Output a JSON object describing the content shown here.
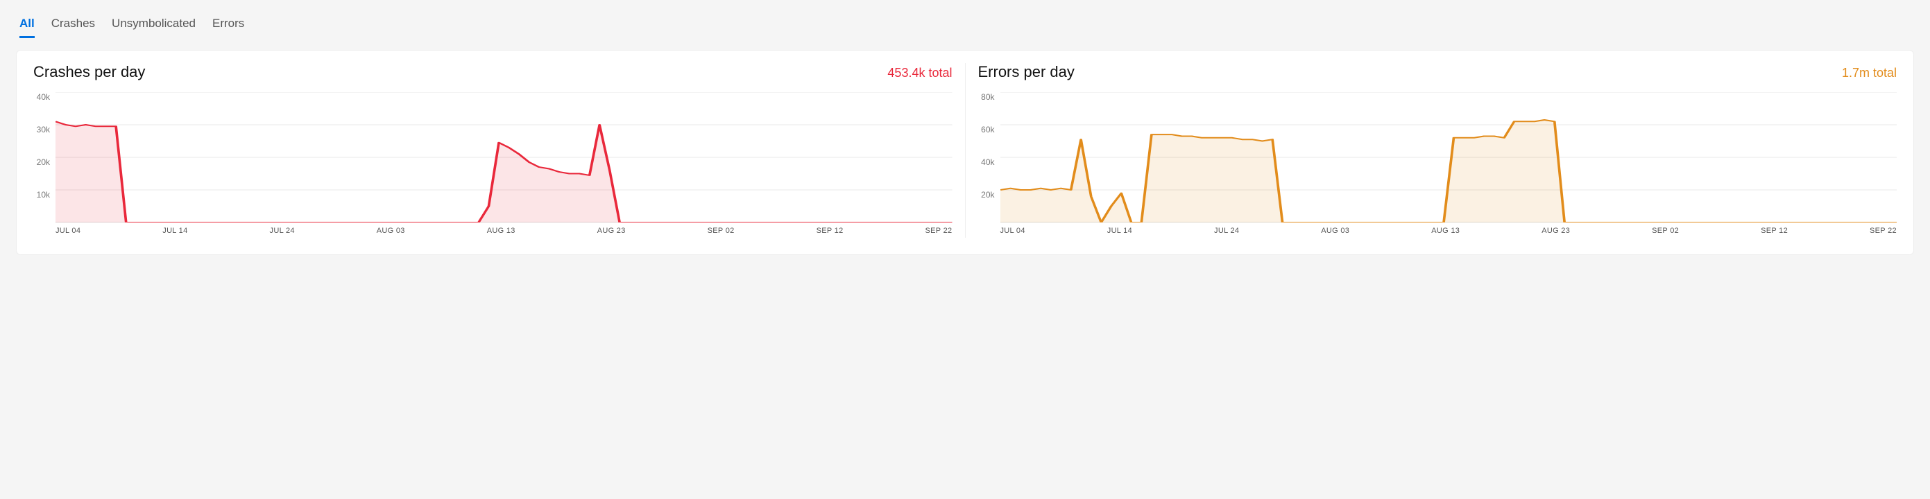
{
  "tabs": [
    {
      "label": "All",
      "active": true
    },
    {
      "label": "Crashes",
      "active": false
    },
    {
      "label": "Unsymbolicated",
      "active": false
    },
    {
      "label": "Errors",
      "active": false
    }
  ],
  "charts": [
    {
      "title": "Crashes per day",
      "total": "453.4k total",
      "color": "red",
      "ymax": 40000,
      "y_ticks": [
        "40k",
        "30k",
        "20k",
        "10k"
      ]
    },
    {
      "title": "Errors per day",
      "total": "1.7m total",
      "color": "orange",
      "ymax": 80000,
      "y_ticks": [
        "80k",
        "60k",
        "40k",
        "20k"
      ]
    }
  ],
  "x_ticks": [
    "JUL 04",
    "JUL 14",
    "JUL 24",
    "AUG 03",
    "AUG 13",
    "AUG 23",
    "SEP 02",
    "SEP 12",
    "SEP 22"
  ],
  "chart_data": [
    {
      "type": "area",
      "title": "Crashes per day",
      "xlabel": "",
      "ylabel": "",
      "ylim": [
        0,
        40000
      ],
      "x": [
        "2016-07-04",
        "2016-07-05",
        "2016-07-06",
        "2016-07-07",
        "2016-07-08",
        "2016-07-09",
        "2016-07-10",
        "2016-07-11",
        "2016-07-12",
        "2016-07-13",
        "2016-07-14",
        "2016-07-15",
        "2016-07-16",
        "2016-07-17",
        "2016-07-18",
        "2016-07-19",
        "2016-07-20",
        "2016-07-21",
        "2016-07-22",
        "2016-07-23",
        "2016-07-24",
        "2016-07-25",
        "2016-07-26",
        "2016-07-27",
        "2016-07-28",
        "2016-07-29",
        "2016-07-30",
        "2016-07-31",
        "2016-08-01",
        "2016-08-02",
        "2016-08-03",
        "2016-08-04",
        "2016-08-05",
        "2016-08-06",
        "2016-08-07",
        "2016-08-08",
        "2016-08-09",
        "2016-08-10",
        "2016-08-11",
        "2016-08-12",
        "2016-08-13",
        "2016-08-14",
        "2016-08-15",
        "2016-08-16",
        "2016-08-17",
        "2016-08-18",
        "2016-08-19",
        "2016-08-20",
        "2016-08-21",
        "2016-08-22",
        "2016-08-23",
        "2016-08-24",
        "2016-08-25",
        "2016-08-26",
        "2016-08-27",
        "2016-08-28",
        "2016-08-29",
        "2016-08-30",
        "2016-08-31",
        "2016-09-01",
        "2016-09-02",
        "2016-09-03",
        "2016-09-04",
        "2016-09-05",
        "2016-09-06",
        "2016-09-07",
        "2016-09-08",
        "2016-09-09",
        "2016-09-10",
        "2016-09-11",
        "2016-09-12",
        "2016-09-13",
        "2016-09-14",
        "2016-09-15",
        "2016-09-16",
        "2016-09-17",
        "2016-09-18",
        "2016-09-19",
        "2016-09-20",
        "2016-09-21",
        "2016-09-22",
        "2016-09-23",
        "2016-09-24",
        "2016-09-25",
        "2016-09-26",
        "2016-09-27",
        "2016-09-28",
        "2016-09-29",
        "2016-09-30",
        "2016-10-01"
      ],
      "values": [
        31000,
        30000,
        29500,
        30000,
        29500,
        29500,
        29500,
        0,
        0,
        0,
        0,
        0,
        0,
        0,
        0,
        0,
        0,
        0,
        0,
        0,
        0,
        0,
        0,
        0,
        0,
        0,
        0,
        0,
        0,
        0,
        0,
        0,
        0,
        0,
        0,
        0,
        0,
        0,
        0,
        0,
        0,
        0,
        0,
        5000,
        24500,
        23000,
        21000,
        18500,
        17000,
        16500,
        15500,
        15000,
        15000,
        14500,
        30000,
        16000,
        0,
        0,
        0,
        0,
        0,
        0,
        0,
        0,
        0,
        0,
        0,
        0,
        0,
        0,
        0,
        0,
        0,
        0,
        0,
        0,
        0,
        0,
        0,
        0,
        0,
        0,
        0,
        0,
        0,
        0,
        0,
        0,
        0,
        0
      ]
    },
    {
      "type": "area",
      "title": "Errors per day",
      "xlabel": "",
      "ylabel": "",
      "ylim": [
        0,
        80000
      ],
      "x": [
        "2016-07-04",
        "2016-07-05",
        "2016-07-06",
        "2016-07-07",
        "2016-07-08",
        "2016-07-09",
        "2016-07-10",
        "2016-07-11",
        "2016-07-12",
        "2016-07-13",
        "2016-07-14",
        "2016-07-15",
        "2016-07-16",
        "2016-07-17",
        "2016-07-18",
        "2016-07-19",
        "2016-07-20",
        "2016-07-21",
        "2016-07-22",
        "2016-07-23",
        "2016-07-24",
        "2016-07-25",
        "2016-07-26",
        "2016-07-27",
        "2016-07-28",
        "2016-07-29",
        "2016-07-30",
        "2016-07-31",
        "2016-08-01",
        "2016-08-02",
        "2016-08-03",
        "2016-08-04",
        "2016-08-05",
        "2016-08-06",
        "2016-08-07",
        "2016-08-08",
        "2016-08-09",
        "2016-08-10",
        "2016-08-11",
        "2016-08-12",
        "2016-08-13",
        "2016-08-14",
        "2016-08-15",
        "2016-08-16",
        "2016-08-17",
        "2016-08-18",
        "2016-08-19",
        "2016-08-20",
        "2016-08-21",
        "2016-08-22",
        "2016-08-23",
        "2016-08-24",
        "2016-08-25",
        "2016-08-26",
        "2016-08-27",
        "2016-08-28",
        "2016-08-29",
        "2016-08-30",
        "2016-08-31",
        "2016-09-01",
        "2016-09-02",
        "2016-09-03",
        "2016-09-04",
        "2016-09-05",
        "2016-09-06",
        "2016-09-07",
        "2016-09-08",
        "2016-09-09",
        "2016-09-10",
        "2016-09-11",
        "2016-09-12",
        "2016-09-13",
        "2016-09-14",
        "2016-09-15",
        "2016-09-16",
        "2016-09-17",
        "2016-09-18",
        "2016-09-19",
        "2016-09-20",
        "2016-09-21",
        "2016-09-22",
        "2016-09-23",
        "2016-09-24",
        "2016-09-25",
        "2016-09-26",
        "2016-09-27",
        "2016-09-28",
        "2016-09-29",
        "2016-09-30",
        "2016-10-01"
      ],
      "values": [
        20000,
        21000,
        20000,
        20000,
        21000,
        20000,
        21000,
        20000,
        51000,
        16000,
        0,
        10000,
        18000,
        0,
        0,
        54000,
        54000,
        54000,
        53000,
        53000,
        52000,
        52000,
        52000,
        52000,
        51000,
        51000,
        50000,
        51000,
        0,
        0,
        0,
        0,
        0,
        0,
        0,
        0,
        0,
        0,
        0,
        0,
        0,
        0,
        0,
        0,
        0,
        52000,
        52000,
        52000,
        53000,
        53000,
        52000,
        62000,
        62000,
        62000,
        63000,
        62000,
        0,
        0,
        0,
        0,
        0,
        0,
        0,
        0,
        0,
        0,
        0,
        0,
        0,
        0,
        0,
        0,
        0,
        0,
        0,
        0,
        0,
        0,
        0,
        0,
        0,
        0,
        0,
        0,
        0,
        0,
        0,
        0,
        0,
        0
      ]
    }
  ]
}
